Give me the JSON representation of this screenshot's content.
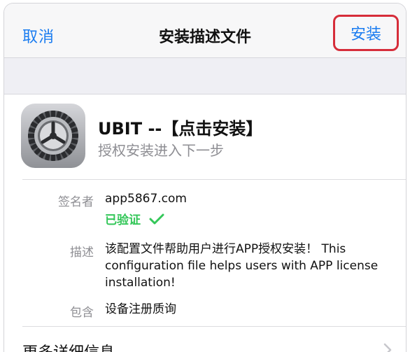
{
  "nav": {
    "cancel_label": "取消",
    "title": "安装描述文件",
    "install_label": "安装"
  },
  "profile": {
    "name": "UBIT  --【点击安装】",
    "subtitle": "授权安装进入下一步",
    "icon": "settings-gear-icon"
  },
  "details": {
    "signer_label": "签名者",
    "signer_value": "app5867.com",
    "verified_label": "已验证",
    "description_label": "描述",
    "description_value": "该配置文件帮助用户进行APP授权安装！ This configuration file helps users with APP license installation!",
    "contains_label": "包含",
    "contains_value": "设备注册质询"
  },
  "more": {
    "label": "更多详细信息"
  },
  "colors": {
    "accent": "#1a7cf0",
    "highlight_border": "#d62d3a",
    "verified": "#34c759",
    "secondary_text": "#8e8e93"
  }
}
